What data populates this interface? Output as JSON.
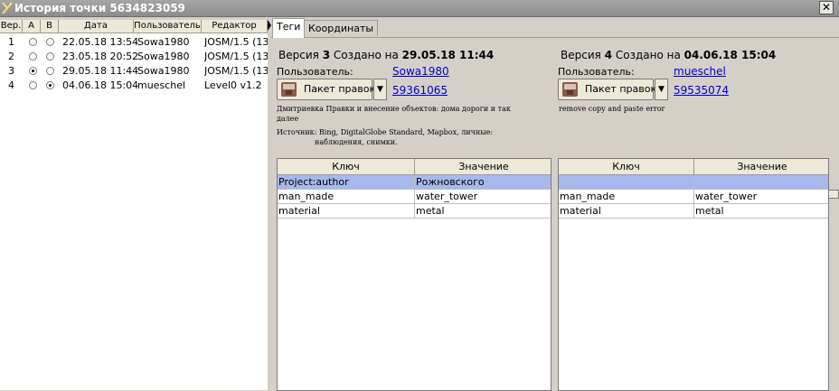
{
  "window": {
    "title": "История точки 5634823059",
    "close_glyph": "✕"
  },
  "history": {
    "headers": [
      "Вер.",
      "A",
      "B",
      "Дата",
      "Пользователь",
      "Редактор"
    ],
    "rows": [
      {
        "ver": "1",
        "a": false,
        "b": false,
        "date": "22.05.18 13:54",
        "user": "Sowa1980",
        "editor": "JOSM/1.5 (13"
      },
      {
        "ver": "2",
        "a": false,
        "b": false,
        "date": "23.05.18 20:52",
        "user": "Sowa1980",
        "editor": "JOSM/1.5 (13"
      },
      {
        "ver": "3",
        "a": true,
        "b": false,
        "date": "29.05.18 11:44",
        "user": "Sowa1980",
        "editor": "JOSM/1.5 (13"
      },
      {
        "ver": "4",
        "a": false,
        "b": true,
        "date": "04.06.18 15:04",
        "user": "mueschel",
        "editor": "Level0 v1.2"
      }
    ]
  },
  "tabs": [
    {
      "label": "Теги",
      "active": true
    },
    {
      "label": "Координаты",
      "active": false
    }
  ],
  "labels": {
    "version_prefix": "Версия",
    "created_on": "Создано на",
    "user_label": "Пользователь:",
    "changeset_button": "Пакет правок",
    "source_label": "Источник:",
    "col_key": "Ключ",
    "col_value": "Значение",
    "dropdown_glyph": "▼"
  },
  "left_version": {
    "number": "3",
    "date": "29.05.18 11:44",
    "user": "Sowa1980",
    "changeset": "59361065",
    "comment_line1": "Дмитриевка Правки и внесение объектов: дома дороги и так",
    "comment_line2": "далее",
    "source_line1": "Bing, DigitalGlobe Standard, Mapbox, личные:",
    "source_line2": "наблюдения, снимки.",
    "tags": [
      {
        "key": "Project:author",
        "value": "Рожновского",
        "highlight": true
      },
      {
        "key": "man_made",
        "value": "water_tower",
        "highlight": false
      },
      {
        "key": "material",
        "value": "metal",
        "highlight": false
      }
    ]
  },
  "right_version": {
    "number": "4",
    "date": "04.06.18 15:04",
    "user": "mueschel",
    "changeset": "59535074",
    "comment_line1": "remove copy and paste error",
    "tags": [
      {
        "key": "",
        "value": "",
        "highlight": true
      },
      {
        "key": "man_made",
        "value": "water_tower",
        "highlight": false
      },
      {
        "key": "material",
        "value": "metal",
        "highlight": false
      }
    ]
  }
}
